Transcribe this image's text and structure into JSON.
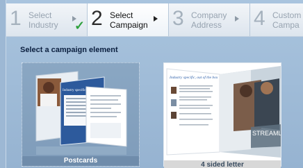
{
  "wizard": {
    "steps": [
      {
        "number": "1",
        "label": "Select Industry",
        "state": "completed"
      },
      {
        "number": "2",
        "label": "Select Campaign",
        "state": "active"
      },
      {
        "number": "3",
        "label": "Company Address",
        "state": "upcoming"
      },
      {
        "number": "4",
        "label": "Custom Campa",
        "state": "upcoming"
      }
    ],
    "completed_icon": "check-icon"
  },
  "main": {
    "heading": "Select a campaign element",
    "elements": [
      {
        "label": "Postcards",
        "selected": true
      },
      {
        "label": "4 sided letter",
        "selected": false
      }
    ]
  },
  "preview_text": {
    "postcard_headline": "Industry specific, out of the box",
    "letter_headline": "Industry specific, out of the box",
    "letter_brand": "STREAMLI"
  },
  "colors": {
    "background": "#9db8d4",
    "check": "#2ea03c",
    "selected_card": "#8aa7c3",
    "heading": "#0b1f3f"
  }
}
